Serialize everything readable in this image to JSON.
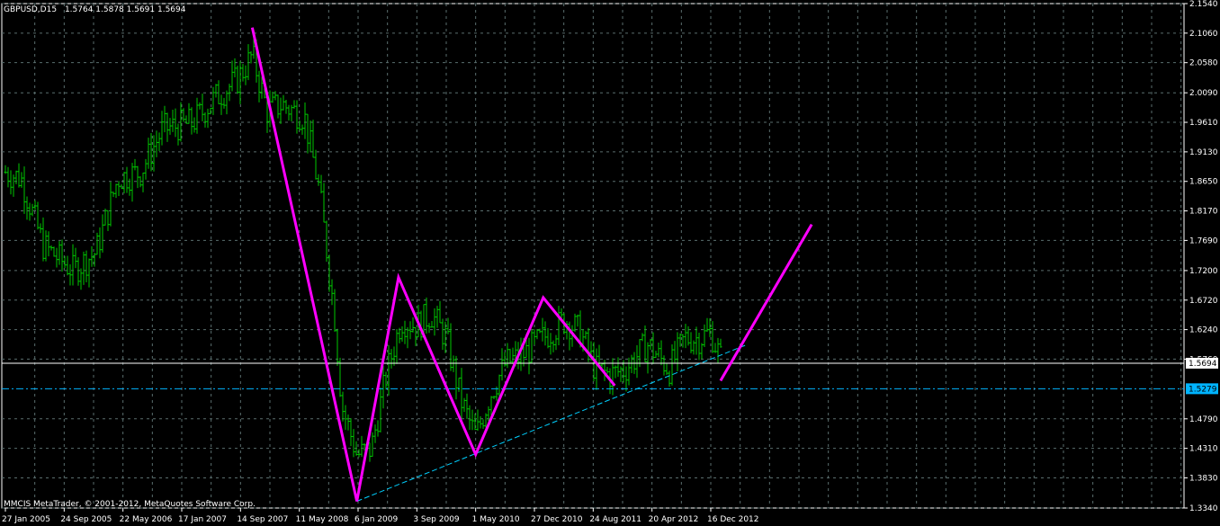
{
  "header": {
    "symbol": "GBPUSD,D15",
    "ohlc": "1.5764 1.5878 1.5691 1.5694"
  },
  "copyright": "MMCIS MetaTrader, © 2001-2012, MetaQuotes Software Corp.",
  "colors": {
    "background": "#000000",
    "grid": "#5a6e6e",
    "bars": "#00c800",
    "pattern": "#ff00ff",
    "trendline": "#00d0ff",
    "level_line": "#00b4ff",
    "price_line": "#ffffff"
  },
  "chart_data": {
    "type": "ohlc",
    "y_ticks": [
      "2.1540",
      "2.1060",
      "2.0580",
      "2.0090",
      "1.9610",
      "1.9130",
      "1.8650",
      "1.8170",
      "1.7690",
      "1.7200",
      "1.6720",
      "1.6240",
      "1.5760",
      "1.5279",
      "1.4790",
      "1.4310",
      "1.3830",
      "1.3340"
    ],
    "ylim": [
      1.334,
      2.154
    ],
    "x_ticks": [
      "27 Jan 2005",
      "24 Sep 2005",
      "22 May 2006",
      "17 Jan 2007",
      "14 Sep 2007",
      "11 May 2008",
      "6 Jan 2009",
      "3 Sep 2009",
      "1 May 2010",
      "27 Dec 2010",
      "24 Aug 2011",
      "20 Apr 2012",
      "16 Dec 2012"
    ],
    "current_price": {
      "label": "1.5694",
      "value": 1.5694
    },
    "level_line": {
      "label": "1.5279",
      "value": 1.5279
    },
    "series": [
      {
        "date": "2005-01-27",
        "close": 1.88
      },
      {
        "date": "2005-04-01",
        "close": 1.87
      },
      {
        "date": "2005-07-01",
        "close": 1.76
      },
      {
        "date": "2005-11-01",
        "close": 1.72
      },
      {
        "date": "2006-02-01",
        "close": 1.75
      },
      {
        "date": "2006-05-01",
        "close": 1.87
      },
      {
        "date": "2006-08-01",
        "close": 1.88
      },
      {
        "date": "2006-11-01",
        "close": 1.95
      },
      {
        "date": "2007-03-01",
        "close": 1.96
      },
      {
        "date": "2007-06-01",
        "close": 2.0
      },
      {
        "date": "2007-09-01",
        "close": 2.03
      },
      {
        "date": "2007-11-01",
        "close": 2.07
      },
      {
        "date": "2008-01-01",
        "close": 1.98
      },
      {
        "date": "2008-03-01",
        "close": 1.99
      },
      {
        "date": "2008-06-01",
        "close": 1.97
      },
      {
        "date": "2008-08-01",
        "close": 1.85
      },
      {
        "date": "2008-10-01",
        "close": 1.65
      },
      {
        "date": "2008-11-01",
        "close": 1.5
      },
      {
        "date": "2009-01-01",
        "close": 1.42
      },
      {
        "date": "2009-03-01",
        "close": 1.43
      },
      {
        "date": "2009-05-01",
        "close": 1.55
      },
      {
        "date": "2009-07-01",
        "close": 1.64
      },
      {
        "date": "2009-09-01",
        "close": 1.63
      },
      {
        "date": "2009-11-01",
        "close": 1.65
      },
      {
        "date": "2010-01-01",
        "close": 1.61
      },
      {
        "date": "2010-03-01",
        "close": 1.51
      },
      {
        "date": "2010-05-01",
        "close": 1.45
      },
      {
        "date": "2010-07-01",
        "close": 1.52
      },
      {
        "date": "2010-09-01",
        "close": 1.57
      },
      {
        "date": "2010-11-01",
        "close": 1.58
      },
      {
        "date": "2011-01-01",
        "close": 1.6
      },
      {
        "date": "2011-03-01",
        "close": 1.62
      },
      {
        "date": "2011-05-01",
        "close": 1.64
      },
      {
        "date": "2011-07-01",
        "close": 1.62
      },
      {
        "date": "2011-09-01",
        "close": 1.56
      },
      {
        "date": "2011-11-01",
        "close": 1.55
      },
      {
        "date": "2012-01-01",
        "close": 1.56
      },
      {
        "date": "2012-04-01",
        "close": 1.6
      },
      {
        "date": "2012-07-01",
        "close": 1.56
      },
      {
        "date": "2012-09-01",
        "close": 1.61
      },
      {
        "date": "2012-11-01",
        "close": 1.61
      },
      {
        "date": "2012-12-16",
        "close": 1.62
      },
      {
        "date": "2013-02-01",
        "close": 1.57
      }
    ],
    "annotations": {
      "pattern_points": [
        {
          "date": "2007-11-01",
          "price": 2.115
        },
        {
          "date": "2009-01-01",
          "price": 1.345
        },
        {
          "date": "2009-06-20",
          "price": 1.709
        },
        {
          "date": "2010-05-01",
          "price": 1.421
        },
        {
          "date": "2011-02-01",
          "price": 1.676
        },
        {
          "date": "2011-11-20",
          "price": 1.533
        }
      ],
      "projection": [
        {
          "date": "2013-01-25",
          "price": 1.541
        },
        {
          "date": "2014-02-01",
          "price": 1.795
        }
      ],
      "trendline": [
        {
          "date": "2009-01-01",
          "price": 1.345
        },
        {
          "date": "2013-05-15",
          "price": 1.6
        }
      ]
    }
  }
}
